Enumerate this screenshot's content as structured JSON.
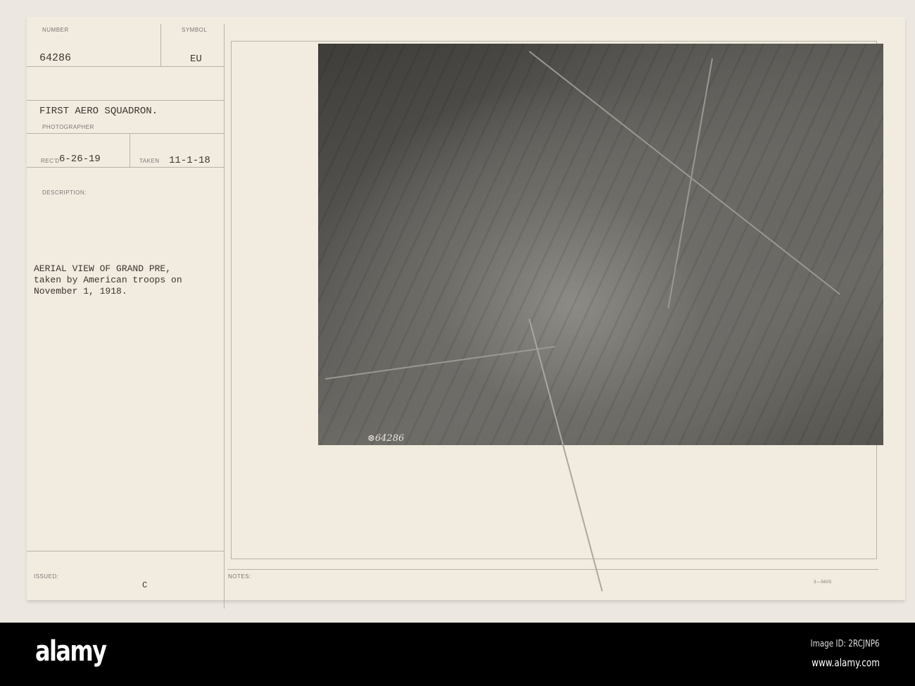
{
  "card": {
    "number_label": "NUMBER",
    "number": "64286",
    "symbol_label": "SYMBOL",
    "symbol": "EU",
    "photographer": "FIRST AERO SQUADRON.",
    "photographer_label": "PHOTOGRAPHER",
    "recd_label": "REC'D",
    "recd": "6-26-19",
    "taken_label": "TAKEN",
    "taken": "11-1-18",
    "description_label": "DESCRIPTION:",
    "description_lines": [
      "AERIAL VIEW OF GRAND PRE,",
      "taken by American troops on",
      "November 1, 1918."
    ],
    "issued_label": "ISSUED:",
    "issued": "C",
    "notes_label": "NOTES:",
    "form_code": "3—5605"
  },
  "photo": {
    "handwritten_number": "⊗64286"
  },
  "watermark": "alamy",
  "footer": {
    "logo": "alamy",
    "image_id": "Image ID: 2RCJNP6",
    "site": "www.alamy.com"
  }
}
